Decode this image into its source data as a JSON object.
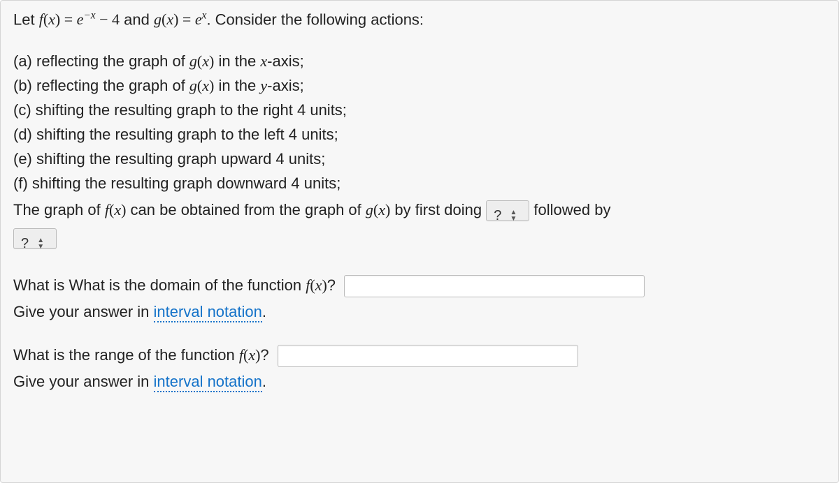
{
  "prompt": {
    "let": "Let ",
    "eq1_a": "f",
    "eq1_b": "(",
    "eq1_c": "x",
    "eq1_d": ") = ",
    "eq1_e": "e",
    "eq1_exp": "−x",
    "eq1_f": " − 4",
    "and": " and ",
    "eq2_a": "g",
    "eq2_b": "(",
    "eq2_c": "x",
    "eq2_d": ") = ",
    "eq2_e": "e",
    "eq2_exp": "x",
    "tail": ". Consider the following actions:"
  },
  "actions": {
    "a": "(a) reflecting the graph of ",
    "a_g": "g",
    "a_par": "(",
    "a_x": "x",
    "a_par2": ")",
    "a_tail": " in the ",
    "a_ax": "x",
    "a_tail2": "-axis;",
    "b": "(b) reflecting the graph of ",
    "b_ax": "y",
    "b_tail2": "-axis;",
    "c": "(c) shifting the resulting graph to the right 4 units;",
    "d": "(d) shifting the resulting graph to the left 4 units;",
    "e": "(e) shifting the resulting graph upward 4 units;",
    "f": "(f) shifting the resulting graph downward 4 units;"
  },
  "answer_line": {
    "pre": "The graph of ",
    "f": "f",
    "p1": "(",
    "x": "x",
    "p2": ")",
    "mid": " can be obtained from the graph of ",
    "g": "g",
    "mid2": " by first doing ",
    "followed": " followed by"
  },
  "select": {
    "placeholder": "?"
  },
  "domain_q": {
    "pre": "What is What is the domain of the function ",
    "f": "f",
    "p1": "(",
    "x": "x",
    "p2": ")",
    "qm": "?",
    "hint_pre": "Give your answer in ",
    "hint_link": "interval notation",
    "hint_post": "."
  },
  "range_q": {
    "pre": "What is the range of the function ",
    "f": "f",
    "p1": "(",
    "x": "x",
    "p2": ")",
    "qm": "?",
    "hint_pre": "Give your answer in ",
    "hint_link": "interval notation",
    "hint_post": "."
  }
}
